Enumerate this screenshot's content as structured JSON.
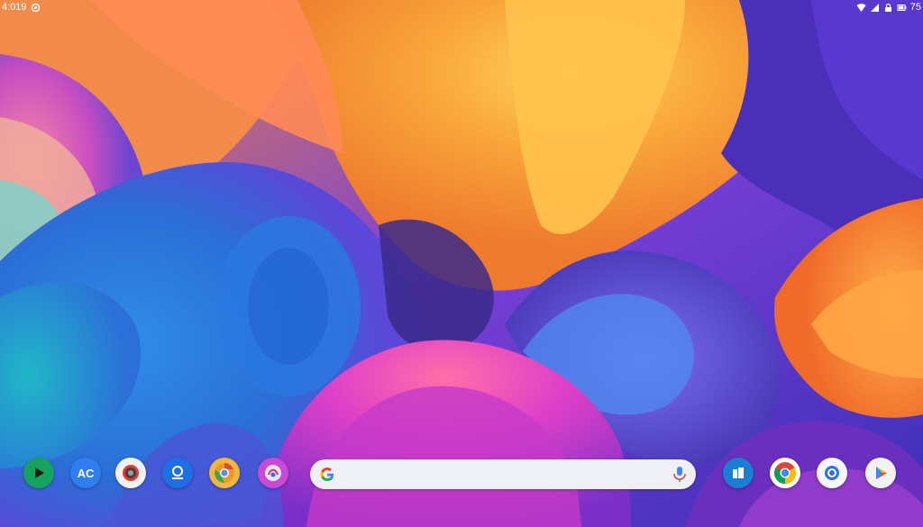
{
  "status_bar": {
    "time": "4:019",
    "battery": "75",
    "icons": [
      "notification-icon",
      "wifi-icon",
      "signal-icon",
      "lock-icon",
      "battery-icon"
    ]
  },
  "dock": {
    "apps": [
      {
        "name": "play-store-icon",
        "label": ""
      },
      {
        "name": "translate-app-icon",
        "label": "AC"
      },
      {
        "name": "camera-icon",
        "label": ""
      },
      {
        "name": "maps-app-icon",
        "label": ""
      },
      {
        "name": "chrome-dev-icon",
        "label": ""
      },
      {
        "name": "photos-app-icon",
        "label": ""
      },
      {
        "name": "files-app-icon",
        "label": ""
      },
      {
        "name": "chrome-icon",
        "label": ""
      },
      {
        "name": "browser-circle-icon",
        "label": ""
      },
      {
        "name": "play-games-icon",
        "label": ""
      }
    ],
    "search": {
      "placeholder": "",
      "icons": [
        "google-g-icon",
        "mic-icon"
      ]
    }
  },
  "colors": {
    "wallpaper_orange": "#f7a63b",
    "wallpaper_blue": "#2e7fe0",
    "wallpaper_purple": "#6a3fd0",
    "wallpaper_magenta": "#d23ccf",
    "search_bg": "#eef0f6"
  }
}
